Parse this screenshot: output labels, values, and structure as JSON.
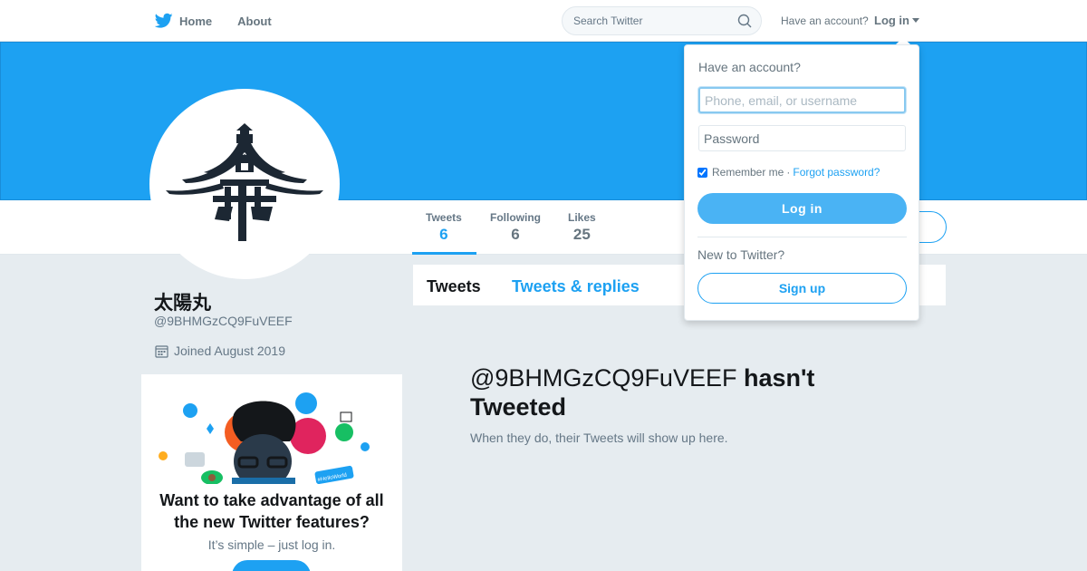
{
  "nav": {
    "home_label": "Home",
    "about_label": "About",
    "search_placeholder": "Search Twitter",
    "have_account": "Have an account?",
    "login_label": "Log in"
  },
  "profile": {
    "name": "太陽丸",
    "handle": "@9BHMGzCQ9FuVEEF",
    "joined": "Joined August 2019",
    "stats": [
      {
        "label": "Tweets",
        "value": "6"
      },
      {
        "label": "Following",
        "value": "6"
      },
      {
        "label": "Likes",
        "value": "25"
      }
    ]
  },
  "tabs": [
    {
      "label": "Tweets"
    },
    {
      "label": "Tweets & replies"
    }
  ],
  "empty_state": {
    "handle": "@9BHMGzCQ9FuVEEF",
    "title_rest": "hasn't Tweeted",
    "subtitle": "When they do, their Tweets will show up here."
  },
  "promo": {
    "title": "Want to take advantage of all the new Twitter features?",
    "subtitle": "It’s simple – just log in.",
    "sticker_text": "#HelloWorld"
  },
  "login_dropdown": {
    "heading": "Have an account?",
    "username_placeholder": "Phone, email, or username",
    "password_placeholder": "Password",
    "remember_label": "Remember me",
    "separator": "·",
    "forgot_label": "Forgot password?",
    "login_button": "Log in",
    "new_to_twitter": "New to Twitter?",
    "signup_button": "Sign up"
  },
  "colors": {
    "brand": "#1da1f2",
    "background": "#e6ecf0",
    "text_secondary": "#657786"
  }
}
